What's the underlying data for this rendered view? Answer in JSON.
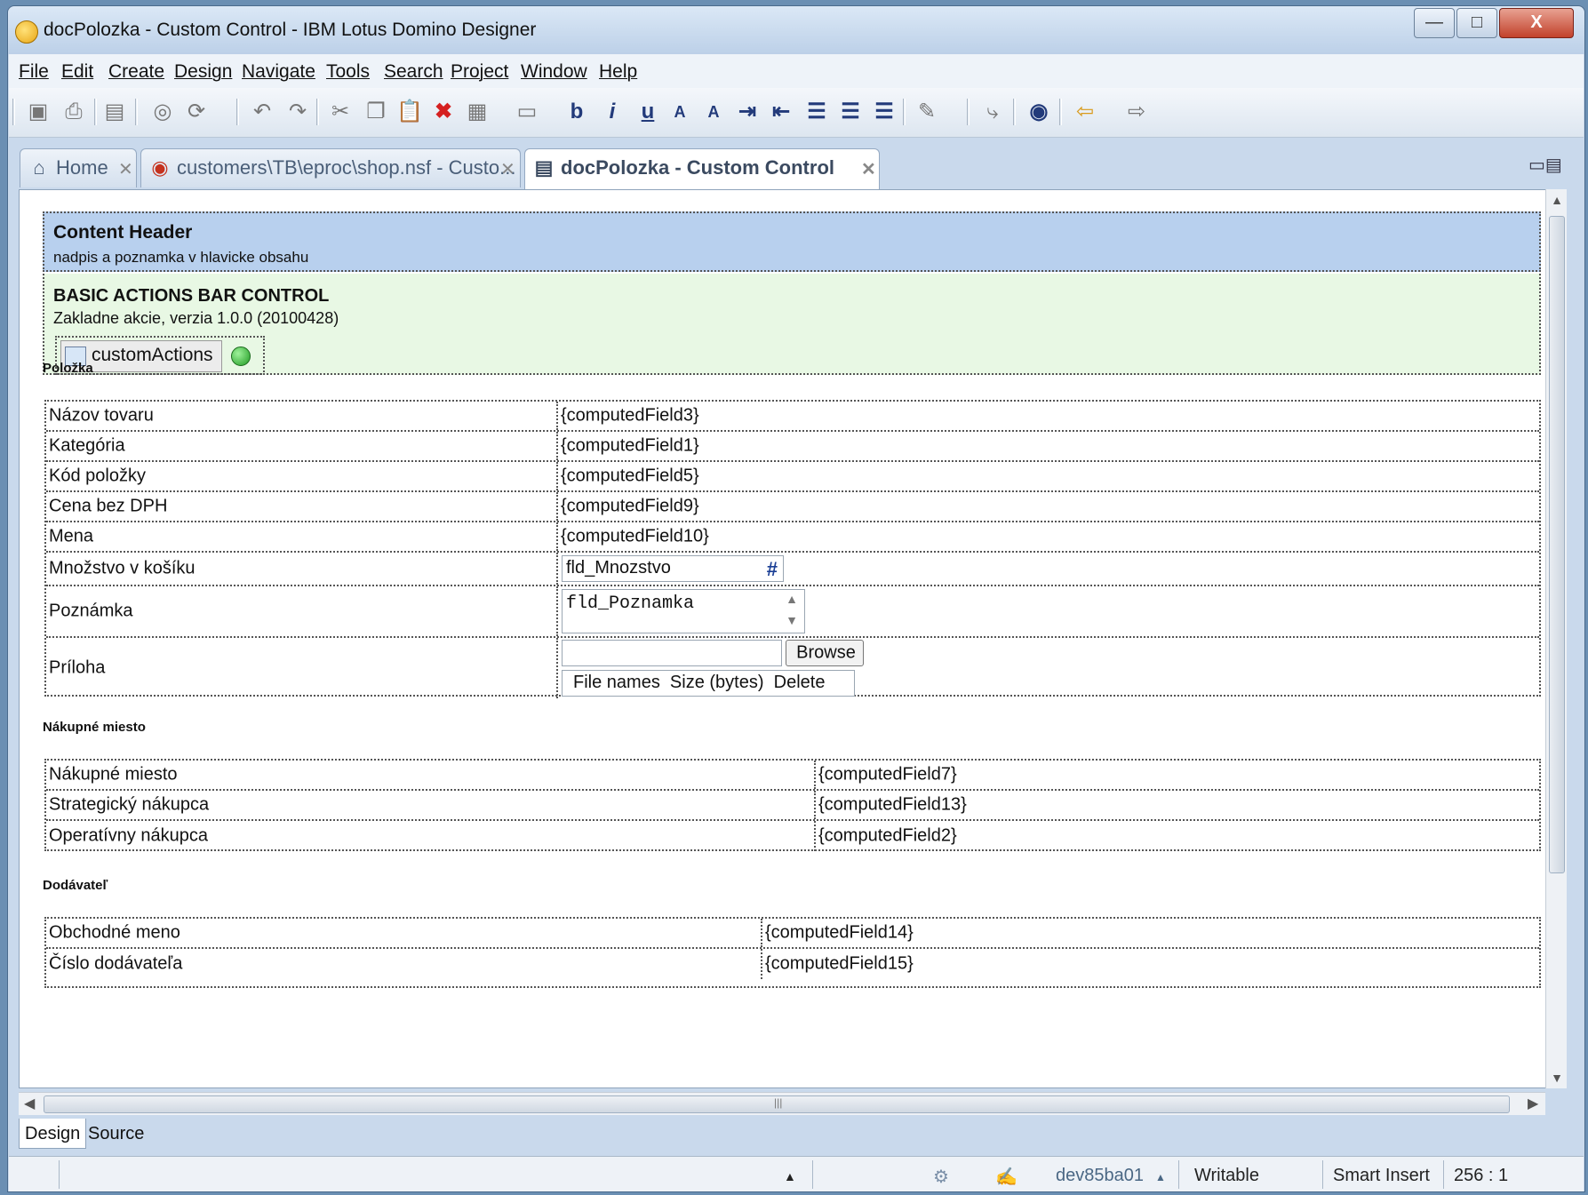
{
  "window": {
    "title": "docPolozka - Custom Control - IBM Lotus Domino Designer",
    "controls": {
      "minimize": "—",
      "maximize": "□",
      "close": "X"
    }
  },
  "menu": [
    "File",
    "Edit",
    "Create",
    "Design",
    "Navigate",
    "Tools",
    "Search",
    "Project",
    "Window",
    "Help"
  ],
  "tabs": [
    {
      "label": "Home",
      "icon": "home-icon",
      "active": false
    },
    {
      "label": "customers\\TB\\eproc\\shop.nsf - Custo...",
      "icon": "database-icon",
      "active": false
    },
    {
      "label": "docPolozka - Custom Control",
      "icon": "custom-control-icon",
      "active": true
    }
  ],
  "content_header": {
    "title": "Content Header",
    "subtitle": "nadpis a poznamka v hlavicke obsahu"
  },
  "actions_bar": {
    "title": "BASIC ACTIONS BAR CONTROL",
    "subtitle": "Zakladne akcie, verzia 1.0.0 (20100428)",
    "button": "customActions"
  },
  "sections": {
    "polozka": {
      "title": "Položka",
      "rows": [
        {
          "label": "Názov tovaru",
          "value": "{computedField3}"
        },
        {
          "label": "Kategória",
          "value": "{computedField1}"
        },
        {
          "label": "Kód položky",
          "value": "{computedField5}"
        },
        {
          "label": "Cena bez DPH",
          "value": "{computedField9}"
        },
        {
          "label": "Mena",
          "value": "{computedField10}"
        },
        {
          "label": "Množstvo v košíku",
          "value": "fld_Mnozstvo"
        },
        {
          "label": "Poznámka",
          "value": "fld_Poznamka"
        },
        {
          "label": "Príloha",
          "value": ""
        }
      ],
      "upload": {
        "browse": "Browse",
        "columns": "File names  Size (bytes)  Delete"
      }
    },
    "nakupne_miesto": {
      "title": "Nákupné miesto",
      "rows": [
        {
          "label": "Nákupné miesto",
          "value": "{computedField7}"
        },
        {
          "label": "Strategický nákupca",
          "value": "{computedField13}"
        },
        {
          "label": "Operatívny nákupca",
          "value": "{computedField2}"
        }
      ]
    },
    "dodavatel": {
      "title": "Dodávateľ",
      "rows": [
        {
          "label": "Obchodné meno",
          "value": "{computedField14}"
        },
        {
          "label": "Číslo dodávateľa",
          "value": "{computedField15}"
        }
      ]
    }
  },
  "bottom_tabs": {
    "design": "Design",
    "source": "Source"
  },
  "status": {
    "server": "dev85ba01",
    "mode": "Writable",
    "insert": "Smart Insert",
    "position": "256 : 1"
  }
}
